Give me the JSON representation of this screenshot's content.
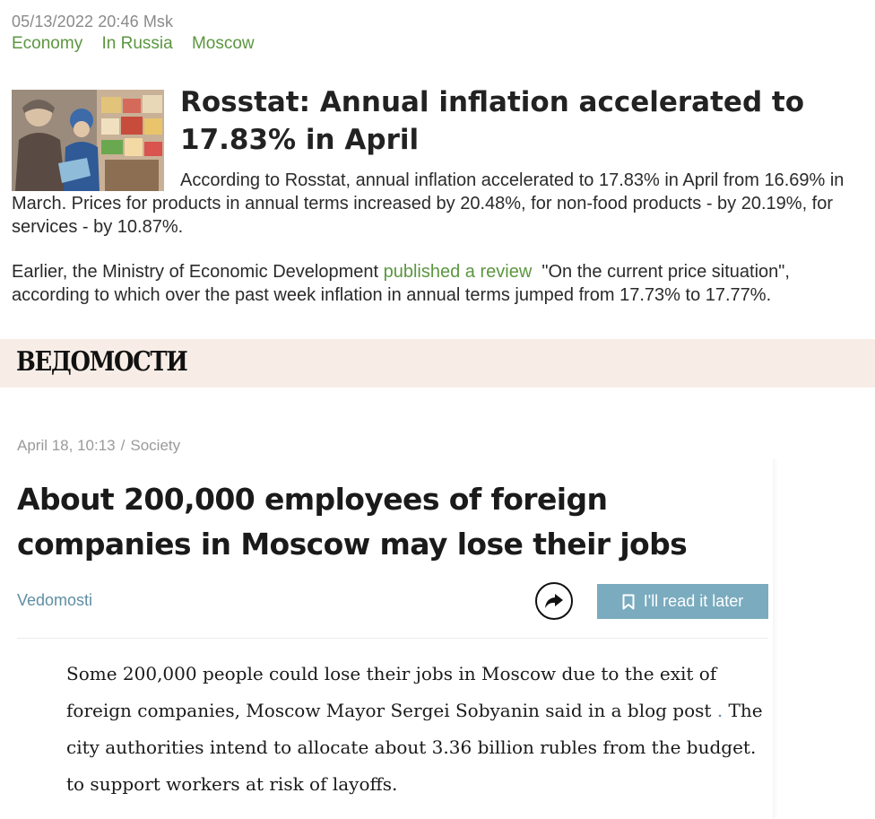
{
  "top_article": {
    "timestamp": "05/13/2022 20:46 Msk",
    "categories": [
      "Economy",
      "In Russia",
      "Moscow"
    ],
    "title": "Rosstat: Annual inflation accelerated to 17.83% in April",
    "para1": "According to Rosstat, annual inflation accelerated to 17.83% in April from 16.69% in March. Prices for products in annual terms increased by 20.48%, for non-food products - by 20.19%, for services - by 10.87%.",
    "para2_prefix": "Earlier, the Ministry of Economic Development ",
    "para2_link": "published a review",
    "para2_suffix": "  \"On the current price situation\", according to which over the past week inflation in annual terms jumped from 17.73% to 17.77%.",
    "link_color": "#5c9640"
  },
  "banner": {
    "logo_text": "ВЕДОМОСТИ",
    "background": "#f7ede6"
  },
  "lower_article": {
    "date": "April 18, 10:13",
    "separator": "/",
    "section": "Society",
    "title": "About 200,000 employees of foreign companies in Moscow may lose their jobs",
    "source": "Vedomosti",
    "share_icon": "share-arrow-icon",
    "read_later_label": "I'll read it later",
    "read_later_icon": "bookmark-icon",
    "button_color": "#7aabbf",
    "body_prefix": "Some 200,000 people could lose their jobs in Moscow due to the exit of foreign companies, Moscow Mayor Sergei Sobyanin said in a blog post ",
    "body_link": ".",
    "body_suffix": " The city authorities intend to allocate about 3.36 billion rubles from the budget. to support workers at risk of layoffs."
  }
}
